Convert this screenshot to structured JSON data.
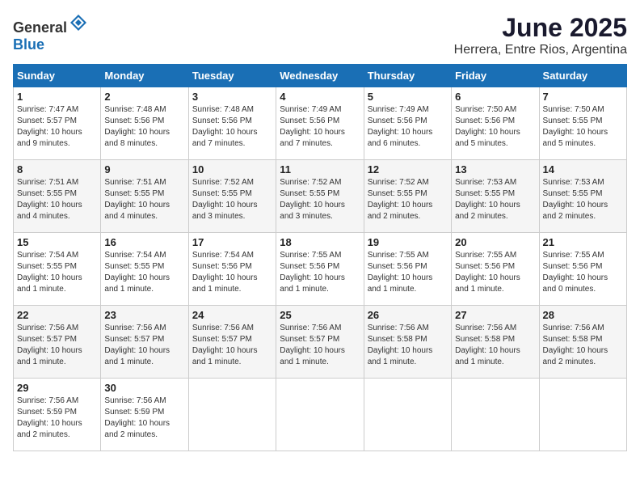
{
  "logo": {
    "text_general": "General",
    "text_blue": "Blue"
  },
  "title": "June 2025",
  "location": "Herrera, Entre Rios, Argentina",
  "days_of_week": [
    "Sunday",
    "Monday",
    "Tuesday",
    "Wednesday",
    "Thursday",
    "Friday",
    "Saturday"
  ],
  "weeks": [
    [
      {
        "day": "1",
        "sunrise": "7:47 AM",
        "sunset": "5:57 PM",
        "daylight": "10 hours and 9 minutes."
      },
      {
        "day": "2",
        "sunrise": "7:48 AM",
        "sunset": "5:56 PM",
        "daylight": "10 hours and 8 minutes."
      },
      {
        "day": "3",
        "sunrise": "7:48 AM",
        "sunset": "5:56 PM",
        "daylight": "10 hours and 7 minutes."
      },
      {
        "day": "4",
        "sunrise": "7:49 AM",
        "sunset": "5:56 PM",
        "daylight": "10 hours and 7 minutes."
      },
      {
        "day": "5",
        "sunrise": "7:49 AM",
        "sunset": "5:56 PM",
        "daylight": "10 hours and 6 minutes."
      },
      {
        "day": "6",
        "sunrise": "7:50 AM",
        "sunset": "5:56 PM",
        "daylight": "10 hours and 5 minutes."
      },
      {
        "day": "7",
        "sunrise": "7:50 AM",
        "sunset": "5:55 PM",
        "daylight": "10 hours and 5 minutes."
      }
    ],
    [
      {
        "day": "8",
        "sunrise": "7:51 AM",
        "sunset": "5:55 PM",
        "daylight": "10 hours and 4 minutes."
      },
      {
        "day": "9",
        "sunrise": "7:51 AM",
        "sunset": "5:55 PM",
        "daylight": "10 hours and 4 minutes."
      },
      {
        "day": "10",
        "sunrise": "7:52 AM",
        "sunset": "5:55 PM",
        "daylight": "10 hours and 3 minutes."
      },
      {
        "day": "11",
        "sunrise": "7:52 AM",
        "sunset": "5:55 PM",
        "daylight": "10 hours and 3 minutes."
      },
      {
        "day": "12",
        "sunrise": "7:52 AM",
        "sunset": "5:55 PM",
        "daylight": "10 hours and 2 minutes."
      },
      {
        "day": "13",
        "sunrise": "7:53 AM",
        "sunset": "5:55 PM",
        "daylight": "10 hours and 2 minutes."
      },
      {
        "day": "14",
        "sunrise": "7:53 AM",
        "sunset": "5:55 PM",
        "daylight": "10 hours and 2 minutes."
      }
    ],
    [
      {
        "day": "15",
        "sunrise": "7:54 AM",
        "sunset": "5:55 PM",
        "daylight": "10 hours and 1 minute."
      },
      {
        "day": "16",
        "sunrise": "7:54 AM",
        "sunset": "5:55 PM",
        "daylight": "10 hours and 1 minute."
      },
      {
        "day": "17",
        "sunrise": "7:54 AM",
        "sunset": "5:56 PM",
        "daylight": "10 hours and 1 minute."
      },
      {
        "day": "18",
        "sunrise": "7:55 AM",
        "sunset": "5:56 PM",
        "daylight": "10 hours and 1 minute."
      },
      {
        "day": "19",
        "sunrise": "7:55 AM",
        "sunset": "5:56 PM",
        "daylight": "10 hours and 1 minute."
      },
      {
        "day": "20",
        "sunrise": "7:55 AM",
        "sunset": "5:56 PM",
        "daylight": "10 hours and 1 minute."
      },
      {
        "day": "21",
        "sunrise": "7:55 AM",
        "sunset": "5:56 PM",
        "daylight": "10 hours and 0 minutes."
      }
    ],
    [
      {
        "day": "22",
        "sunrise": "7:56 AM",
        "sunset": "5:57 PM",
        "daylight": "10 hours and 1 minute."
      },
      {
        "day": "23",
        "sunrise": "7:56 AM",
        "sunset": "5:57 PM",
        "daylight": "10 hours and 1 minute."
      },
      {
        "day": "24",
        "sunrise": "7:56 AM",
        "sunset": "5:57 PM",
        "daylight": "10 hours and 1 minute."
      },
      {
        "day": "25",
        "sunrise": "7:56 AM",
        "sunset": "5:57 PM",
        "daylight": "10 hours and 1 minute."
      },
      {
        "day": "26",
        "sunrise": "7:56 AM",
        "sunset": "5:58 PM",
        "daylight": "10 hours and 1 minute."
      },
      {
        "day": "27",
        "sunrise": "7:56 AM",
        "sunset": "5:58 PM",
        "daylight": "10 hours and 1 minute."
      },
      {
        "day": "28",
        "sunrise": "7:56 AM",
        "sunset": "5:58 PM",
        "daylight": "10 hours and 2 minutes."
      }
    ],
    [
      {
        "day": "29",
        "sunrise": "7:56 AM",
        "sunset": "5:59 PM",
        "daylight": "10 hours and 2 minutes."
      },
      {
        "day": "30",
        "sunrise": "7:56 AM",
        "sunset": "5:59 PM",
        "daylight": "10 hours and 2 minutes."
      },
      null,
      null,
      null,
      null,
      null
    ]
  ]
}
